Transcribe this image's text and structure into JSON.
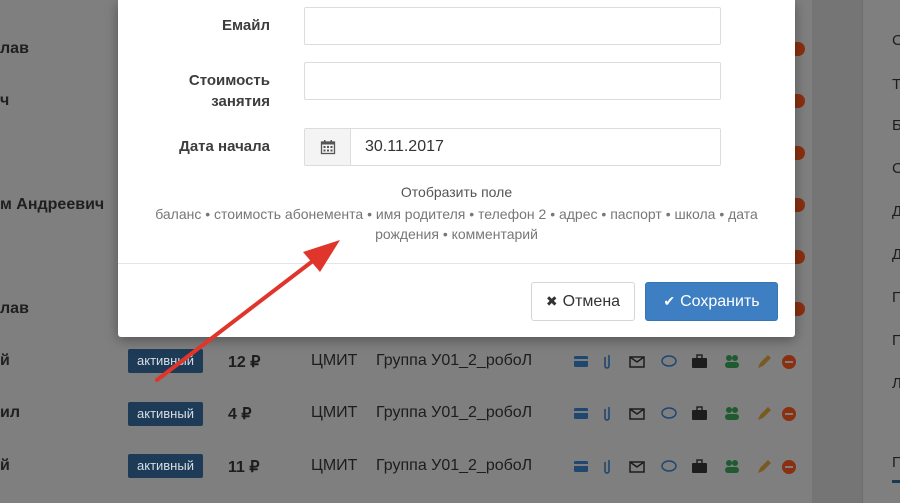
{
  "background": {
    "rows": [
      {
        "name": "",
        "top": 0
      },
      {
        "name": "лав"
      },
      {
        "name": "ч"
      },
      {
        "name": ""
      },
      {
        "name": "м Андреевич"
      },
      {
        "name": ""
      },
      {
        "name": "лав"
      }
    ],
    "table_rows": [
      {
        "name": "й",
        "status": "активный",
        "price": "12 ₽",
        "org": "ЦМИТ",
        "group": "Группа У01_2_робоЛ"
      },
      {
        "name": "ил",
        "status": "активный",
        "price": "4 ₽",
        "org": "ЦМИТ",
        "group": "Группа У01_2_робоЛ"
      },
      {
        "name": "й",
        "status": "активный",
        "price": "11 ₽",
        "org": "ЦМИТ",
        "group": "Группа У01_2_робоЛ"
      }
    ],
    "right_letters": [
      "С",
      "Т",
      "Б",
      "С",
      "Д",
      "Д",
      "П",
      "П",
      "Л",
      "П"
    ]
  },
  "modal": {
    "email_label": "Емайл",
    "email_value": "",
    "cost_label_line1": "Стоимость",
    "cost_label_line2": "занятия",
    "cost_value": "",
    "start_date_label": "Дата начала",
    "start_date_value": "30.11.2017",
    "show_field_title": "Отобразить поле",
    "show_field_options_line1": "баланс • стоимость абонемента • имя родителя • телефон 2 • адрес • паспорт • школа • дата",
    "show_field_options_line2": "рождения • комментарий",
    "cancel_label": "Отмена",
    "save_label": "Сохранить"
  },
  "colors": {
    "primary": "#3d7fc2",
    "badge": "#1d3b57",
    "arrow": "#e0352b"
  }
}
